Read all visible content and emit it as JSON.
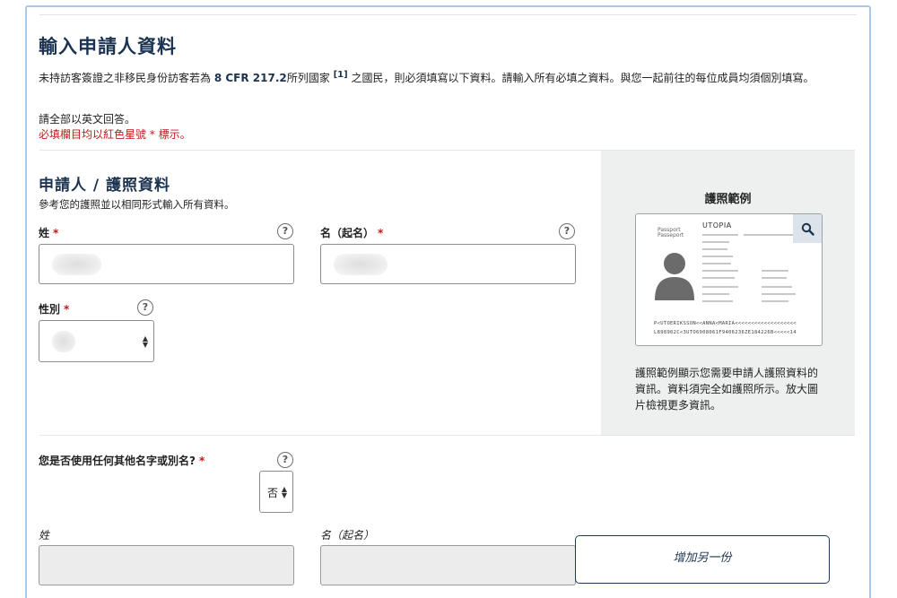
{
  "page": {
    "title": "輸入申請人資料",
    "intro_pre": "未持訪客簽證之非移民身份訪客若為 ",
    "intro_cfr": "8 CFR 217.2",
    "intro_mid": "所列國家 ",
    "intro_ref": "[1]",
    "intro_post": " 之國民，則必須填寫以下資料。請輸入所有必填之資料。與您一起前往的每位成員均須個別填寫。",
    "note_english": "請全部以英文回答。",
    "note_required": "必填欄目均以紅色星號 * 標示。"
  },
  "section": {
    "title": "申請人 / 護照資料",
    "subtitle": "參考您的護照並以相同形式輸入所有資料。"
  },
  "fields": {
    "surname_label": "姓",
    "given_label": "名（起名）",
    "gender_label": "性別",
    "required_mark": "*",
    "help_glyph": "?"
  },
  "alias": {
    "question": "您是否使用任何其他名字或別名?",
    "select_value": "否",
    "surname_label": "姓",
    "given_label": "名（起名）",
    "add_button": "增加另一份"
  },
  "sidebar": {
    "title": "護照範例",
    "description": "護照範例顯示您需要申請人護照資料的資訊。資料須完全如護照所示。放大圖片檢視更多資訊。",
    "passport": {
      "type_line1": "Passport",
      "type_line2": "Passeport",
      "country": "UTOPIA",
      "mrz1": "P<UTOERIKSSON<<ANNA<MARIA<<<<<<<<<<<<<<<<<<<",
      "mrz2": "L898902C<3UTO6908061F9406236ZE184226B<<<<<14"
    }
  },
  "colors": {
    "heading": "#1b3350",
    "required": "#c0191a",
    "frame": "#a9c8ea",
    "sidebar_bg": "#eef0ef"
  }
}
